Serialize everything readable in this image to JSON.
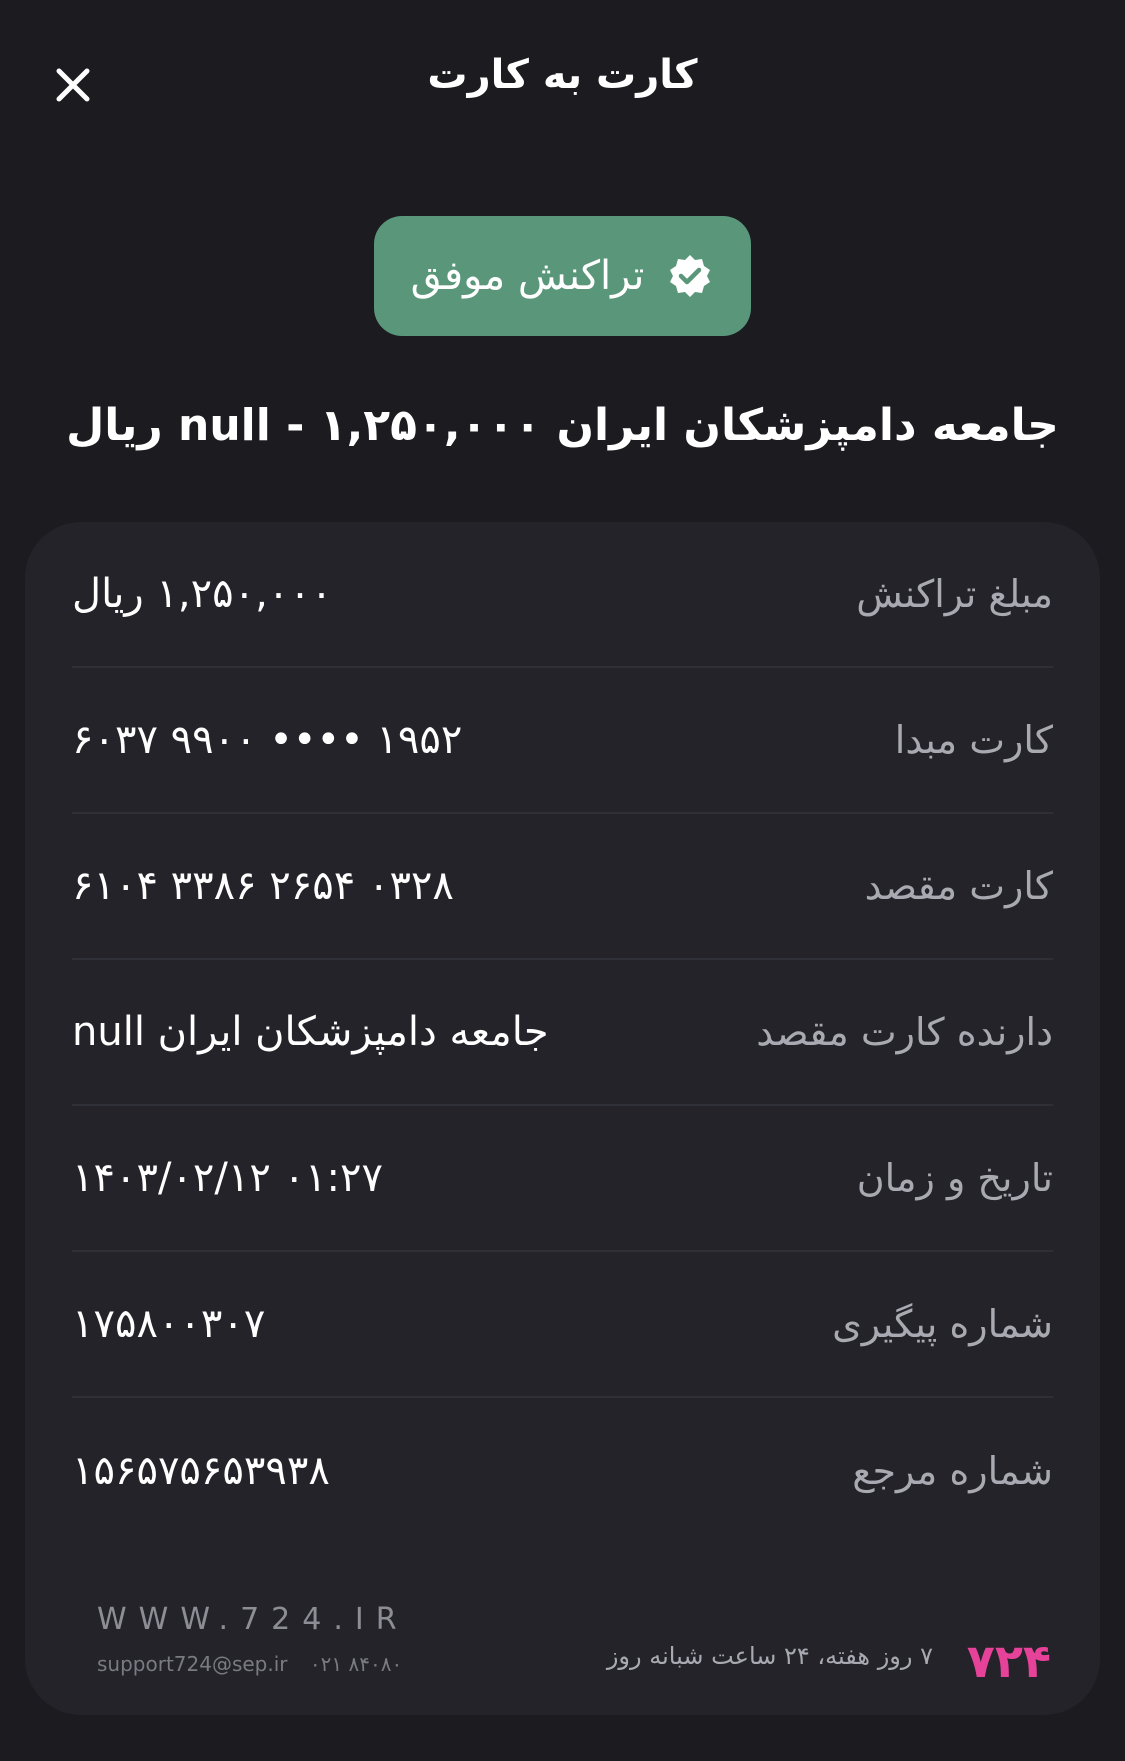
{
  "header": {
    "title": "کارت به کارت",
    "close_icon": "close-icon"
  },
  "status": {
    "label": "تراکنش موفق",
    "icon": "verified-check-icon",
    "color": "#5a977a"
  },
  "merchant_line": "جامعه دامپزشکان ایران null - ۱,۲۵۰,۰۰۰ ریال",
  "details": [
    {
      "label": "مبلغ تراکنش",
      "value": "۱,۲۵۰,۰۰۰ ریال"
    },
    {
      "label": "کارت مبدا",
      "value": "۶۰۳۷ ۹۹۰۰ •••• ۱۹۵۲"
    },
    {
      "label": "کارت مقصد",
      "value": "۶۱۰۴ ۳۳۸۶ ۲۶۵۴ ۰۳۲۸"
    },
    {
      "label": "دارنده کارت مقصد",
      "value": "جامعه دامپزشکان ایران null"
    },
    {
      "label": "تاریخ و زمان",
      "value": "۱۴۰۳/۰۲/۱۲ ۰۱:۲۷"
    },
    {
      "label": "شماره پیگیری",
      "value": "۱۷۵۸۰۰۳۰۷"
    },
    {
      "label": "شماره مرجع",
      "value": "۱۵۶۵۷۵۶۵۳۹۳۸"
    }
  ],
  "footer": {
    "site": "WWW.724.IR",
    "email": "support724@sep.ir",
    "phone": "۰۲۱ ۸۴۰۸۰",
    "slogan": "۷ روز هفته، ۲۴ ساعت شبانه روز",
    "logo": "۷۲۴",
    "logo_color": "#e6429a"
  }
}
